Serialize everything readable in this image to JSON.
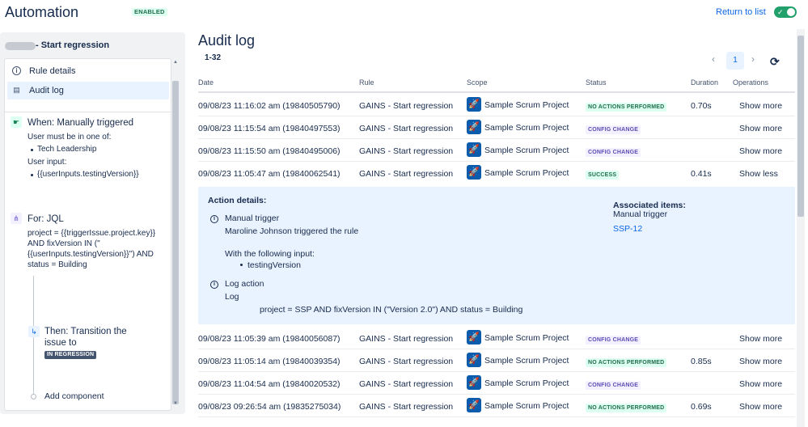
{
  "header": {
    "title": "Automation",
    "enabled_badge": "ENABLED",
    "return_link": "Return to list",
    "toggle_on": true
  },
  "sidebar": {
    "rule_name": "- Start regression",
    "nav": [
      {
        "label": "Rule details",
        "icon": "info-icon"
      },
      {
        "label": "Audit log",
        "icon": "document-icon",
        "active": true
      }
    ],
    "trigger": {
      "title": "When: Manually triggered",
      "lines": [
        "User must be in one of:",
        "Tech Leadership",
        "User input:",
        "{{userInputs.testingVersion}}"
      ]
    },
    "branch": {
      "title": "For: JQL",
      "lines": [
        "project = {{triggerIssue.project.key}}",
        "AND fixVersion IN (\"",
        "{{userInputs.testingVersion}}\") AND",
        "status = Building"
      ]
    },
    "action": {
      "title_line1": "Then: Transition the",
      "title_line2": "issue to",
      "status": "IN REGRESSION"
    },
    "add_component": "Add component"
  },
  "main": {
    "title": "Audit log",
    "range": "1-32",
    "page": "1",
    "columns": [
      "Date",
      "Rule",
      "Scope",
      "Status",
      "Duration",
      "Operations"
    ],
    "rows_top": [
      {
        "date": "09/08/23 11:16:02 am (19840505790)",
        "rule": "GAINS - Start regression",
        "scope": "Sample Scrum Project",
        "status": "NO ACTIONS PERFORMED",
        "status_color": "green",
        "duration": "0.70s",
        "op": "Show more"
      },
      {
        "date": "09/08/23 11:15:54 am (19840497553)",
        "rule": "GAINS - Start regression",
        "scope": "Sample Scrum Project",
        "status": "CONFIG CHANGE",
        "status_color": "purple",
        "duration": "",
        "op": "Show more"
      },
      {
        "date": "09/08/23 11:15:50 am (19840495006)",
        "rule": "GAINS - Start regression",
        "scope": "Sample Scrum Project",
        "status": "CONFIG CHANGE",
        "status_color": "purple",
        "duration": "",
        "op": "Show more"
      },
      {
        "date": "09/08/23 11:05:47 am (19840062541)",
        "rule": "GAINS - Start regression",
        "scope": "Sample Scrum Project",
        "status": "SUCCESS",
        "status_color": "green",
        "duration": "0.41s",
        "op": "Show less"
      }
    ],
    "details": {
      "title": "Action details:",
      "trigger_heading": "Manual trigger",
      "trigger_text": "Maroline Johnson triggered the rule",
      "input_heading": "With the following input:",
      "input_item": "testingVersion",
      "log_heading": "Log action",
      "log_label": "Log",
      "log_text": "project = SSP AND fixVersion IN (\"Version 2.0\") AND status = Building",
      "assoc_heading": "Associated items:",
      "assoc_label": "Manual trigger",
      "assoc_link": "SSP-12"
    },
    "rows_bottom": [
      {
        "date": "09/08/23 11:05:39 am (19840056087)",
        "rule": "GAINS - Start regression",
        "scope": "Sample Scrum Project",
        "status": "CONFIG CHANGE",
        "status_color": "purple",
        "duration": "",
        "op": "Show more"
      },
      {
        "date": "09/08/23 11:05:14 am (19840039354)",
        "rule": "GAINS - Start regression",
        "scope": "Sample Scrum Project",
        "status": "NO ACTIONS PERFORMED",
        "status_color": "green",
        "duration": "0.85s",
        "op": "Show more"
      },
      {
        "date": "09/08/23 11:04:54 am (19840020532)",
        "rule": "GAINS - Start regression",
        "scope": "Sample Scrum Project",
        "status": "CONFIG CHANGE",
        "status_color": "purple",
        "duration": "",
        "op": "Show more"
      },
      {
        "date": "09/08/23 09:26:54 am (19835275034)",
        "rule": "GAINS - Start regression",
        "scope": "Sample Scrum Project",
        "status": "NO ACTIONS PERFORMED",
        "status_color": "green",
        "duration": "0.69s",
        "op": "Show more"
      }
    ]
  }
}
